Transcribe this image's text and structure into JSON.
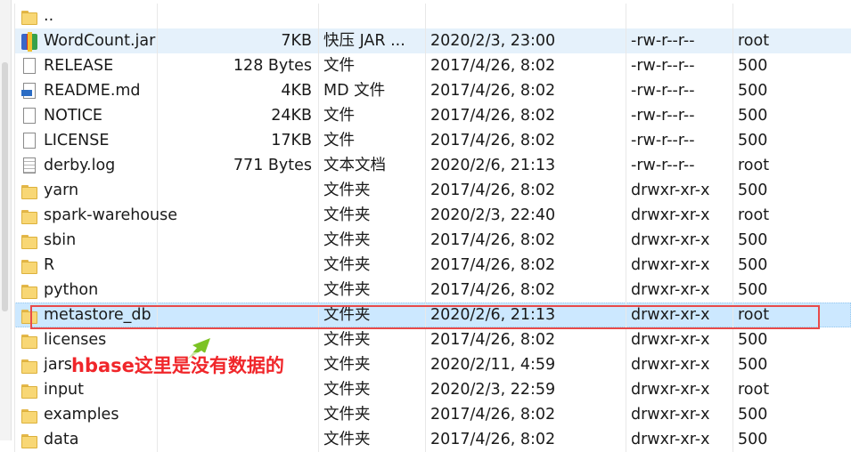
{
  "colors": {
    "highlight": "#e84a4a",
    "annotation": "#f0262a",
    "arrow": "#7cc324",
    "selected": "#cce8ff"
  },
  "files": [
    {
      "icon": "folder",
      "name": "..",
      "size": "",
      "type": "",
      "date": "",
      "perm": "",
      "owner": ""
    },
    {
      "icon": "jar",
      "name": "WordCount.jar",
      "size": "7KB",
      "type": "快压 JAR ...",
      "date": "2020/2/3, 23:00",
      "perm": "-rw-r--r--",
      "owner": "root"
    },
    {
      "icon": "file",
      "name": "RELEASE",
      "size": "128 Bytes",
      "type": "文件",
      "date": "2017/4/26, 8:02",
      "perm": "-rw-r--r--",
      "owner": "500"
    },
    {
      "icon": "md",
      "name": "README.md",
      "size": "4KB",
      "type": "MD 文件",
      "date": "2017/4/26, 8:02",
      "perm": "-rw-r--r--",
      "owner": "500"
    },
    {
      "icon": "file",
      "name": "NOTICE",
      "size": "24KB",
      "type": "文件",
      "date": "2017/4/26, 8:02",
      "perm": "-rw-r--r--",
      "owner": "500"
    },
    {
      "icon": "file",
      "name": "LICENSE",
      "size": "17KB",
      "type": "文件",
      "date": "2017/4/26, 8:02",
      "perm": "-rw-r--r--",
      "owner": "500"
    },
    {
      "icon": "log",
      "name": "derby.log",
      "size": "771 Bytes",
      "type": "文本文档",
      "date": "2020/2/6, 21:13",
      "perm": "-rw-r--r--",
      "owner": "root"
    },
    {
      "icon": "folder",
      "name": "yarn",
      "size": "",
      "type": "文件夹",
      "date": "2017/4/26, 8:02",
      "perm": "drwxr-xr-x",
      "owner": "500"
    },
    {
      "icon": "folder",
      "name": "spark-warehouse",
      "size": "",
      "type": "文件夹",
      "date": "2020/2/3, 22:40",
      "perm": "drwxr-xr-x",
      "owner": "root"
    },
    {
      "icon": "folder",
      "name": "sbin",
      "size": "",
      "type": "文件夹",
      "date": "2017/4/26, 8:02",
      "perm": "drwxr-xr-x",
      "owner": "500"
    },
    {
      "icon": "folder",
      "name": "R",
      "size": "",
      "type": "文件夹",
      "date": "2017/4/26, 8:02",
      "perm": "drwxr-xr-x",
      "owner": "500"
    },
    {
      "icon": "folder",
      "name": "python",
      "size": "",
      "type": "文件夹",
      "date": "2017/4/26, 8:02",
      "perm": "drwxr-xr-x",
      "owner": "500"
    },
    {
      "icon": "folder",
      "name": "metastore_db",
      "size": "",
      "type": "文件夹",
      "date": "2020/2/6, 21:13",
      "perm": "drwxr-xr-x",
      "owner": "root"
    },
    {
      "icon": "folder",
      "name": "licenses",
      "size": "",
      "type": "文件夹",
      "date": "2017/4/26, 8:02",
      "perm": "drwxr-xr-x",
      "owner": "500"
    },
    {
      "icon": "folder",
      "name": "jars",
      "size": "",
      "type": "文件夹",
      "date": "2020/2/11, 4:59",
      "perm": "drwxr-xr-x",
      "owner": "500"
    },
    {
      "icon": "folder",
      "name": "input",
      "size": "",
      "type": "文件夹",
      "date": "2020/2/3, 22:59",
      "perm": "drwxr-xr-x",
      "owner": "root"
    },
    {
      "icon": "folder",
      "name": "examples",
      "size": "",
      "type": "文件夹",
      "date": "2017/4/26, 8:02",
      "perm": "drwxr-xr-x",
      "owner": "500"
    },
    {
      "icon": "folder",
      "name": "data",
      "size": "",
      "type": "文件夹",
      "date": "2017/4/26, 8:02",
      "perm": "drwxr-xr-x",
      "owner": "500"
    }
  ],
  "selected_row": 12,
  "hover_row": 1,
  "annotation": {
    "text": "hbase这里是没有数据的"
  }
}
